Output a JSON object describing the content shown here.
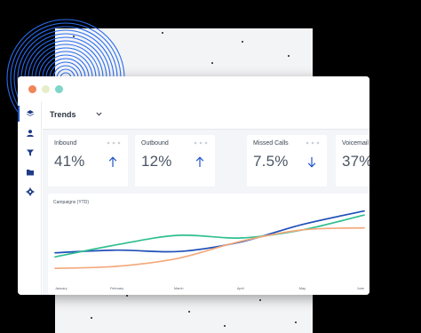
{
  "window": {
    "dot_colors": [
      "#f0855a",
      "#e6edc9",
      "#7fd6c8"
    ]
  },
  "sidebar": {
    "items": [
      {
        "icon": "layers-icon",
        "active": true
      },
      {
        "icon": "user-icon"
      },
      {
        "icon": "filter-icon"
      },
      {
        "icon": "folder-icon"
      },
      {
        "icon": "gear-icon"
      }
    ]
  },
  "toolbar": {
    "view_label": "Trends"
  },
  "stats": [
    {
      "label": "Inbound",
      "value": "41%",
      "trend": "up"
    },
    {
      "label": "Outbound",
      "value": "12%",
      "trend": "up"
    },
    {
      "label": "Missed Calls",
      "value": "7.5%",
      "trend": "down"
    },
    {
      "label": "Voicemail",
      "value": "37%"
    }
  ],
  "chart_data": {
    "type": "line",
    "title": "Campaigns (YTD)",
    "x": [
      "January",
      "February",
      "March",
      "April",
      "May",
      "June"
    ],
    "ylim": [
      0,
      100
    ],
    "grid": false,
    "series": [
      {
        "color": "#1f4fb8",
        "values": [
          28,
          32,
          30,
          44,
          70,
          90
        ]
      },
      {
        "color": "#2fbf8f",
        "values": [
          22,
          40,
          54,
          50,
          62,
          84
        ]
      },
      {
        "color": "#f3a97c",
        "values": [
          5,
          8,
          20,
          45,
          62,
          65
        ]
      }
    ]
  }
}
